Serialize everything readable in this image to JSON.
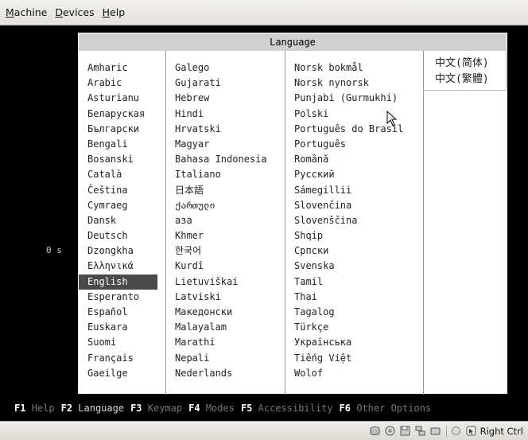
{
  "menubar": {
    "items": [
      {
        "first": "M",
        "rest": "achine"
      },
      {
        "first": "D",
        "rest": "evices"
      },
      {
        "first": "H",
        "rest": "elp"
      }
    ]
  },
  "dialog": {
    "title": "Language",
    "columns": [
      [
        "Amharic",
        "Arabic",
        "Asturianu",
        "Беларуская",
        "Български",
        "Bengali",
        "Bosanski",
        "Català",
        "Čeština",
        "Cymraeg",
        "Dansk",
        "Deutsch",
        "Dzongkha",
        "Ελληνικά",
        "English",
        "Esperanto",
        "Español",
        "Euskara",
        "Suomi",
        "Français",
        "Gaeilge"
      ],
      [
        "Galego",
        "Gujarati",
        "Hebrew",
        "Hindi",
        "Hrvatski",
        "Magyar",
        "Bahasa Indonesia",
        "Italiano",
        "日本語",
        "ქართული",
        "аза",
        "Khmer",
        "한국어",
        "Kurdî",
        "Lietuviškai",
        "Latviski",
        "Македонски",
        "Malayalam",
        "Marathi",
        "Nepali",
        "Nederlands"
      ],
      [
        "Norsk bokmål",
        "Norsk nynorsk",
        "Punjabi (Gurmukhi)",
        "Polski",
        "Português do Brasil",
        "Português",
        "Română",
        "Русский",
        "Sámegillii",
        "Slovenčina",
        "Slovenščina",
        "Shqip",
        "Српски",
        "Svenska",
        "Tamil",
        "Thai",
        "Tagalog",
        "Türkçe",
        "Українська",
        "Tiếng Việt",
        "Wolof"
      ],
      [
        "中文(简体)",
        "中文(繁體)"
      ]
    ],
    "selected": "English"
  },
  "timeout": "0 s",
  "fkeys": [
    {
      "key": "F1",
      "label": "Help"
    },
    {
      "key": "F2",
      "label": "Language"
    },
    {
      "key": "F3",
      "label": "Keymap"
    },
    {
      "key": "F4",
      "label": "Modes"
    },
    {
      "key": "F5",
      "label": "Accessibility"
    },
    {
      "key": "F6",
      "label": "Other Options"
    }
  ],
  "statusbar": {
    "icons": [
      "hard-disk-icon",
      "cd-rom-icon",
      "floppy-icon",
      "network-icon",
      "usb-icon",
      "shared-folders-icon",
      "mouse-integration-icon",
      "capture-icon"
    ],
    "host_key": "Right Ctrl"
  }
}
